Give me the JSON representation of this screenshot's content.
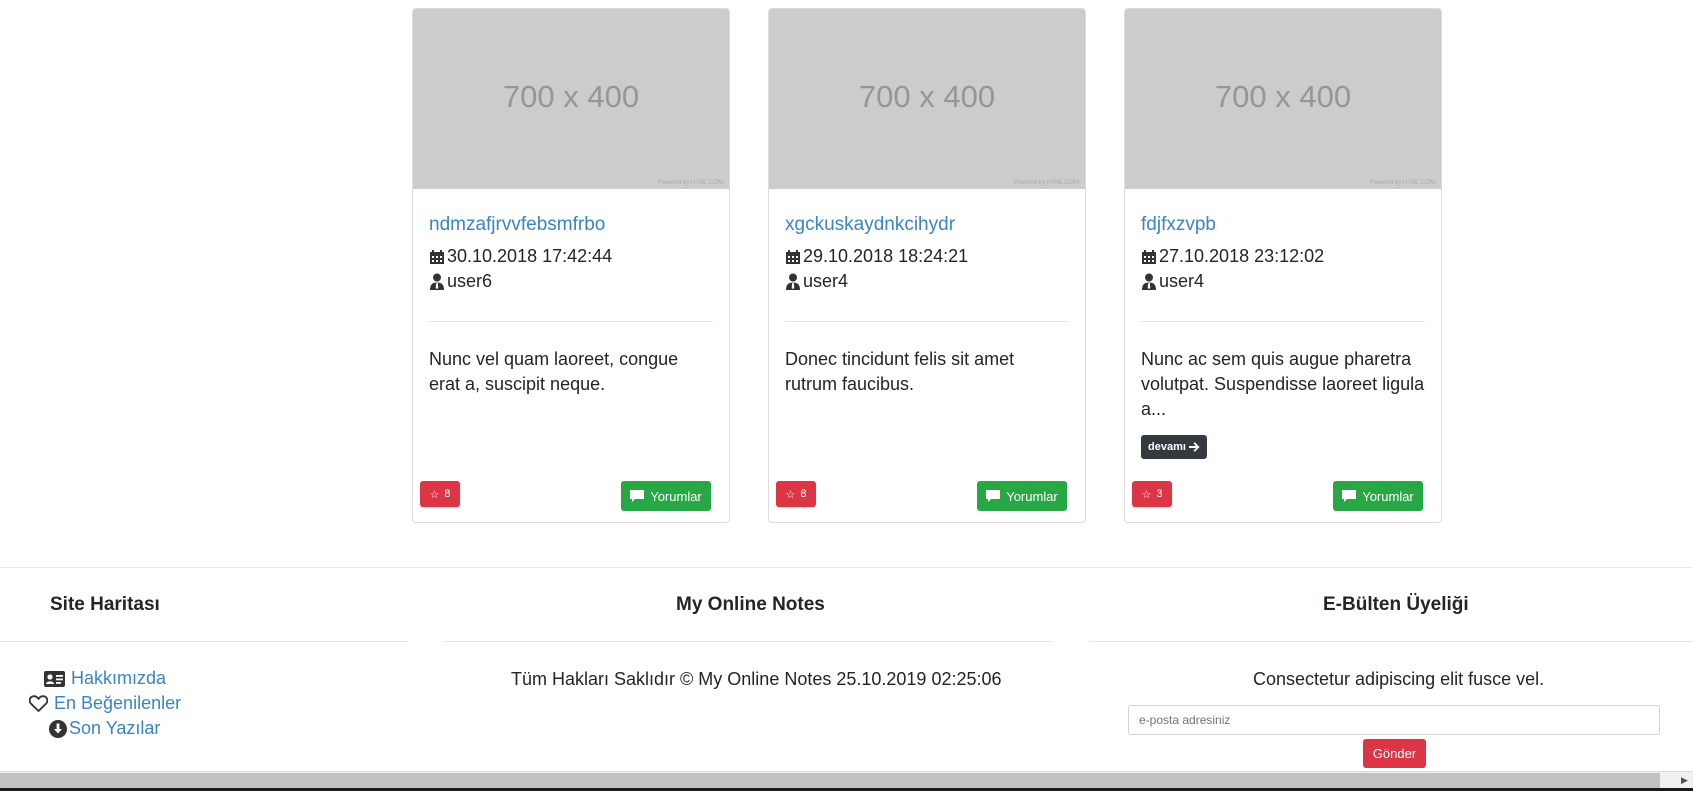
{
  "cards": [
    {
      "image_text": "700 x 400",
      "image_credit": "Powered by HTML.COM",
      "title": "ndmzafjrvvfebsmfrbo",
      "date": "30.10.2018 17:42:44",
      "author": "user6",
      "excerpt": "Nunc vel quam laoreet, congue erat a, suscipit neque.",
      "likes": "8",
      "comments_label": "Yorumlar"
    },
    {
      "image_text": "700 x 400",
      "image_credit": "Powered by HTML.COM",
      "title": "xgckuskaydnkcihydr",
      "date": "29.10.2018 18:24:21",
      "author": "user4",
      "excerpt": "Donec tincidunt felis sit amet rutrum faucibus.",
      "likes": "8",
      "comments_label": "Yorumlar"
    },
    {
      "image_text": "700 x 400",
      "image_credit": "Powered by HTML.COM",
      "title": "fdjfxzvpb",
      "date": "27.10.2018 23:12:02",
      "author": "user4",
      "excerpt": "Nunc ac sem quis augue pharetra volutpat. Suspendisse laoreet ligula a...",
      "more_label": "devamı",
      "likes": "3",
      "comments_label": "Yorumlar"
    }
  ],
  "footer": {
    "sitemap": {
      "heading": "Site Haritası",
      "links": [
        "Hakkımızda",
        "En Beğenilenler",
        "Son Yazılar"
      ]
    },
    "center": {
      "heading": "My Online Notes",
      "copyright": "Tüm Hakları Saklıdır © My Online Notes 25.10.2019 02:25:06"
    },
    "newsletter": {
      "heading": "E-Bülten Üyeliği",
      "text": "Consectetur adipiscing elit fusce vel.",
      "placeholder": "e-posta adresiniz",
      "button": "Gönder"
    }
  },
  "colors": {
    "link": "#3b84c4",
    "danger": "#dc3545",
    "success": "#28a745",
    "dark": "#343a40"
  }
}
